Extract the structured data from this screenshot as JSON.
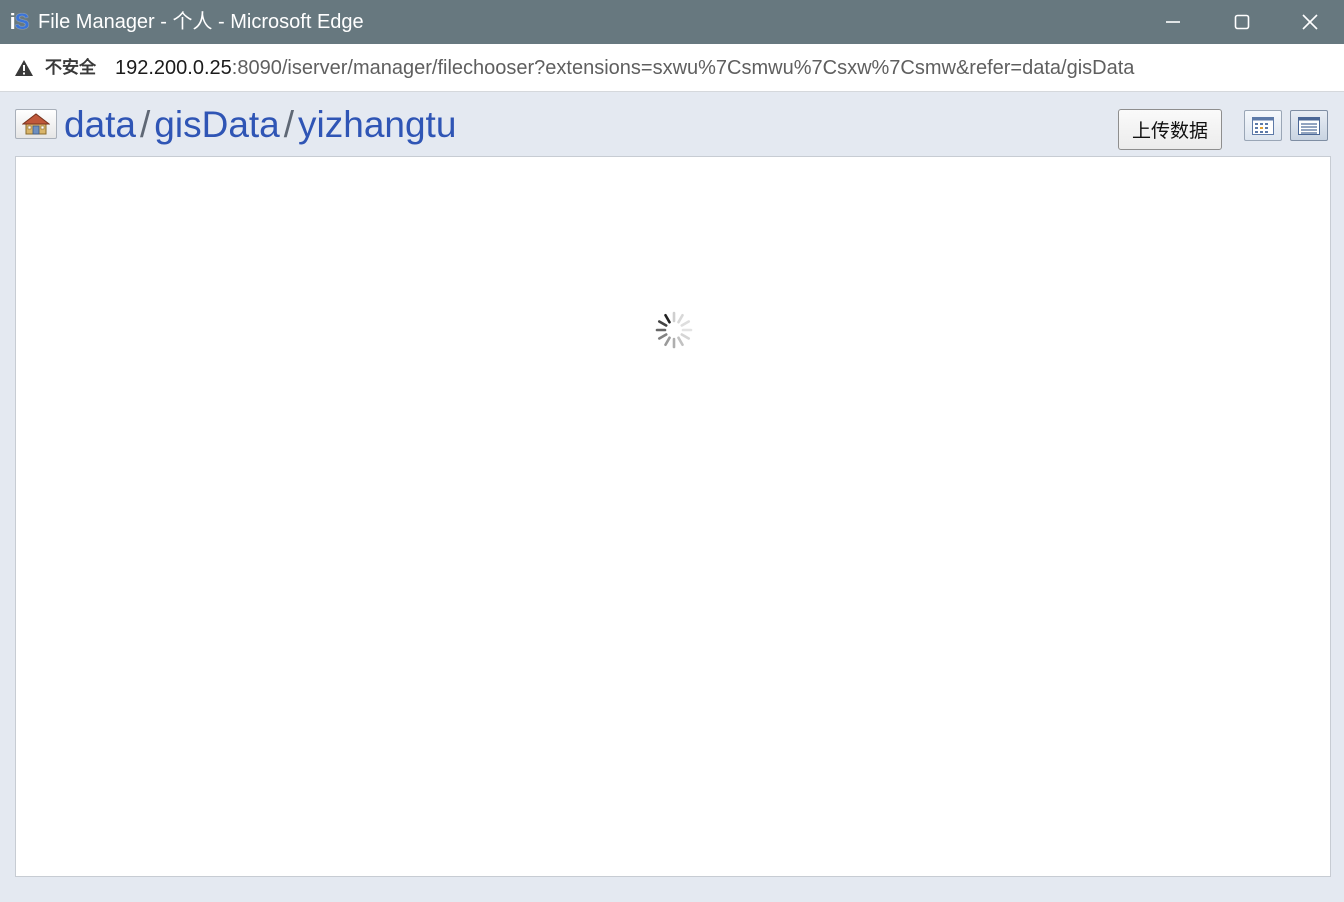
{
  "window": {
    "title": "File Manager - 个人 - Microsoft Edge",
    "app_icon": "iserver-logo-icon",
    "controls": {
      "minimize_icon": "minimize-icon",
      "maximize_icon": "maximize-icon",
      "close_icon": "close-icon"
    }
  },
  "address_bar": {
    "security_icon": "warning-icon",
    "security_label": "不安全",
    "url_host": "192.200.0.25",
    "url_rest": ":8090/iserver/manager/filechooser?extensions=sxwu%7Csmwu%7Csxw%7Csmw&refer=data/gisData"
  },
  "toolbar": {
    "home_icon": "home-icon",
    "breadcrumb": [
      {
        "label": "data"
      },
      {
        "label": "gisData"
      },
      {
        "label": "yizhangtu"
      }
    ],
    "separator": "/",
    "upload_label": "上传数据",
    "view_buttons": {
      "grid_icon": "grid-view-icon",
      "list_icon": "list-view-icon"
    }
  },
  "file_panel": {
    "state_icon": "loading-spinner-icon"
  },
  "colors": {
    "titlebar": "#67787f",
    "page_background": "#e4e9f1",
    "breadcrumb_link": "#2f55b5"
  }
}
